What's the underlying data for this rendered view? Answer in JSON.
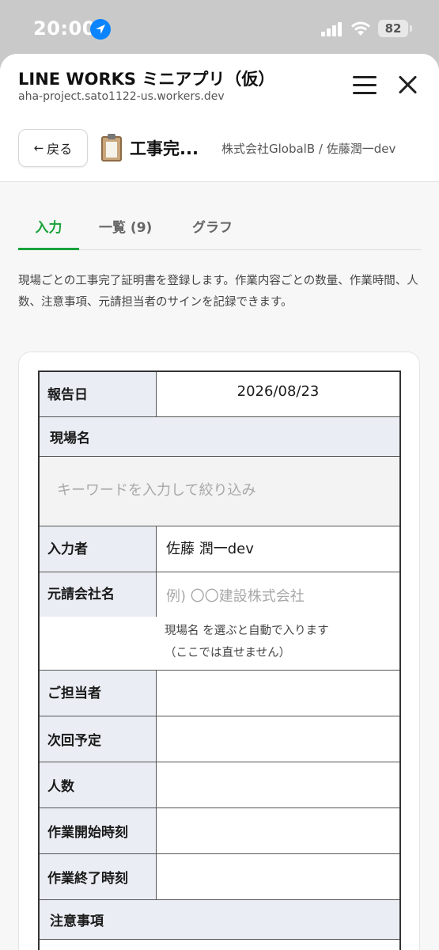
{
  "status_bar": {
    "time": "20:00",
    "battery": "82"
  },
  "header": {
    "app_title": "LINE WORKS ミニアプリ（仮）",
    "app_url": "aha-project.sato1122-us.workers.dev",
    "back_label": "戻る",
    "page_title": "工事完...",
    "user_org": "株式会社GlobalB / 佐藤潤一dev"
  },
  "tabs": [
    {
      "label": "入力",
      "active": true
    },
    {
      "label": "一覧 (9)",
      "active": false
    },
    {
      "label": "グラフ",
      "active": false
    }
  ],
  "description": "現場ごとの工事完了証明書を登録します。作業内容ごとの数量、作業時間、人数、注意事項、元請担当者のサインを記録できます。",
  "form": {
    "report_date_label": "報告日",
    "report_date_value": "2026/08/23",
    "site_name_label": "現場名",
    "site_search_placeholder": "キーワードを入力して絞り込み",
    "entered_by_label": "入力者",
    "entered_by_value": "佐藤 潤一dev",
    "company_label": "元請会社名",
    "company_placeholder": "例) 〇〇建設株式会社",
    "company_note_1": "現場名 を選ぶと自動で入ります",
    "company_note_2": "（ここでは直せません）",
    "contact_label": "ご担当者",
    "next_schedule_label": "次回予定",
    "headcount_label": "人数",
    "start_time_label": "作業開始時刻",
    "end_time_label": "作業終了時刻",
    "notes_label": "注意事項"
  },
  "colors": {
    "accent": "#1aa23a",
    "label_bg": "#eaeef4"
  }
}
